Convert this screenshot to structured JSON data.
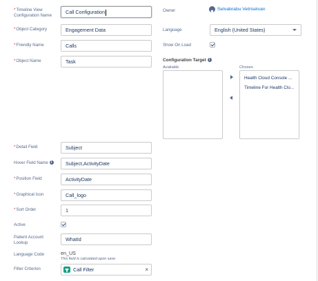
{
  "left": {
    "timeline_view_name": {
      "label": "Timeline View Configuration Name",
      "value": "Call Configuration"
    },
    "object_category": {
      "label": "Object Category",
      "value": "Engagement Data"
    },
    "friendly_name": {
      "label": "Friendly Name",
      "value": "Calls"
    },
    "object_name": {
      "label": "Object Name",
      "value": "Task"
    },
    "detail_field": {
      "label": "Detail Field",
      "value": "Subject"
    },
    "hover_field_name": {
      "label": "Hover Field Name",
      "value": "Subject,ActivityDate"
    },
    "position_field": {
      "label": "Position Field",
      "value": "ActivityDate"
    },
    "graphical_icon": {
      "label": "Graphical Icon",
      "value": "Call_logo"
    },
    "sort_order": {
      "label": "Sort Order",
      "value": "1"
    },
    "active": {
      "label": "Active",
      "checked": true
    },
    "patient_account_lookup": {
      "label": "Patient Account Lookup",
      "value": "WhatId"
    },
    "language_code": {
      "label": "Language Code",
      "value": "en_US",
      "hint": "This field is calculated upon save"
    },
    "filter_criterion": {
      "label": "Filter Criterion",
      "value": "Call Filter",
      "icon": "filter-lookup-icon",
      "icon_color": "#16a085"
    }
  },
  "right": {
    "owner": {
      "label": "Owner",
      "value": "Selvabrabu Vetriselvan",
      "icon": "user-avatar-icon"
    },
    "language": {
      "label": "Language",
      "value": "English (United States)"
    },
    "show_on_load": {
      "label": "Show On Load",
      "checked": true
    },
    "configuration_target": {
      "label": "Configuration Target",
      "available_label": "Available",
      "chosen_label": "Chosen",
      "available": [],
      "chosen": [
        "Health Cloud Console ...",
        "Timeline For Health Clo..."
      ]
    }
  },
  "required_marker": "*",
  "info_glyph": "i"
}
